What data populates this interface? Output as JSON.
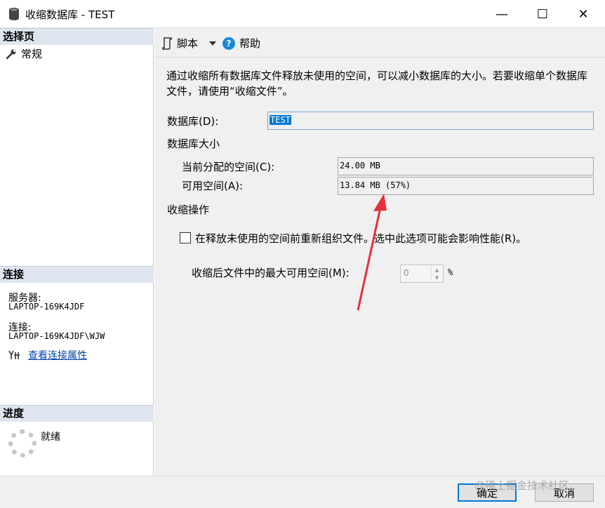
{
  "window": {
    "title": "收缩数据库 - TEST",
    "controls": {
      "minimize": "—",
      "maximize": "☐",
      "close": "✕"
    }
  },
  "left": {
    "select_page_header": "选择页",
    "nav_items": [
      {
        "label": "常规",
        "icon": "wrench-icon"
      }
    ],
    "connection_header": "连接",
    "server_label": "服务器:",
    "server_value": "LAPTOP-169K4JDF",
    "connection_label": "连接:",
    "connection_value": "LAPTOP-169K4JDF\\WJW",
    "view_properties_link": "查看连接属性",
    "progress_header": "进度",
    "progress_status": "就绪"
  },
  "toolbar": {
    "script_label": "脚本",
    "help_label": "帮助"
  },
  "main": {
    "description": "通过收缩所有数据库文件释放未使用的空间，可以减小数据库的大小。若要收缩单个数据库文件，请使用“收缩文件”。",
    "database_label": "数据库(D):",
    "database_value": "TEST",
    "db_size_heading": "数据库大小",
    "allocated_label": "当前分配的空间(C):",
    "allocated_value": "24.00 MB",
    "available_label": "可用空间(A):",
    "available_value": "13.84 MB (57%)",
    "shrink_ops_heading": "收缩操作",
    "reorganize_checkbox_label": "在释放未使用的空间前重新组织文件。选中此选项可能会影响性能(R)。",
    "reorganize_checked": false,
    "max_free_label": "收缩后文件中的最大可用空间(M):",
    "max_free_value": "0",
    "percent_unit": "%"
  },
  "footer": {
    "ok_label": "确定",
    "cancel_label": "取消",
    "watermark": "@稀土掘金技术社区"
  },
  "colors": {
    "accent": "#0078d7",
    "section_header_bg": "#dee5ee",
    "annotation_arrow": "#e8303a"
  }
}
